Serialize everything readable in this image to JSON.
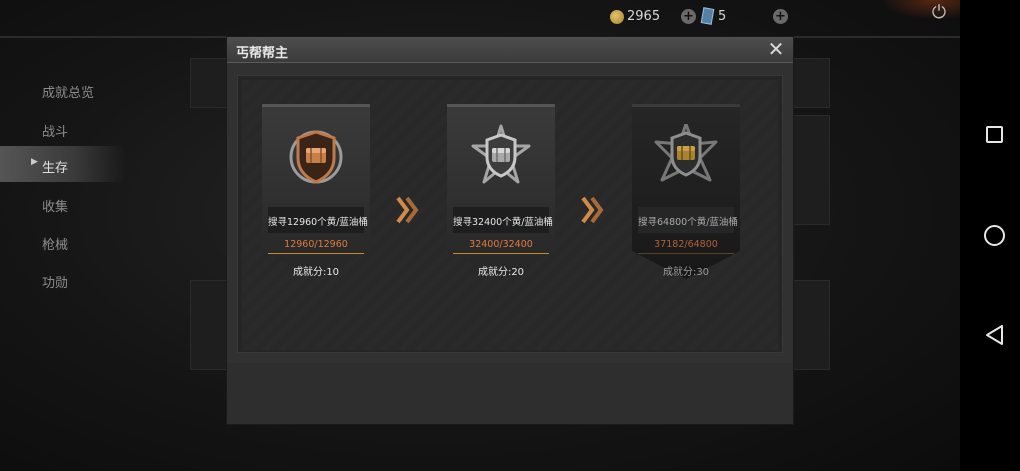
{
  "topbar": {
    "coins": "2965",
    "cards": "5"
  },
  "menu": {
    "items": [
      {
        "label": "成就总览"
      },
      {
        "label": "战斗"
      },
      {
        "label": "生存"
      },
      {
        "label": "收集"
      },
      {
        "label": "枪械"
      },
      {
        "label": "功勋"
      }
    ],
    "active_index": 2
  },
  "modal": {
    "title": "丐帮帮主",
    "tiers": [
      {
        "desc": "搜寻12960个黄/蓝油桶",
        "progress": "12960/12960",
        "points": "成就分:10",
        "medal": "bronze",
        "accent": "#c07a4a"
      },
      {
        "desc": "搜寻32400个黄/蓝油桶",
        "progress": "32400/32400",
        "points": "成就分:20",
        "medal": "silver",
        "accent": "#b9b9b9"
      },
      {
        "desc": "搜寻64800个黄/蓝油桶",
        "progress": "37182/64800",
        "points": "成就分:30",
        "medal": "gold",
        "accent": "#c79a3c"
      }
    ]
  },
  "colors": {
    "progress_text": "#e07a3c",
    "divider_gold": "#c78a2c",
    "chevron": "#d08a4a"
  }
}
